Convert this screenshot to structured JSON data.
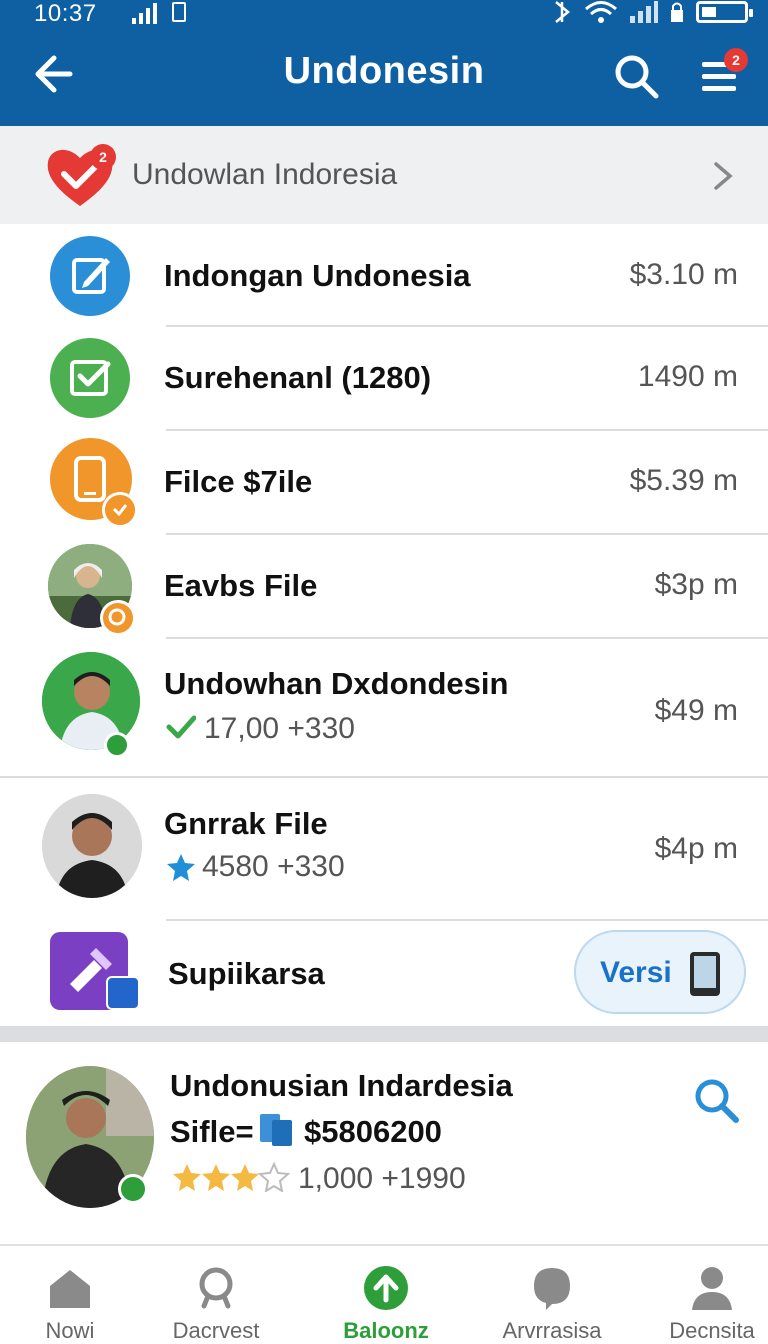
{
  "status_bar": {
    "time": "10:37"
  },
  "app_bar": {
    "title": "Undonesin",
    "menu_badge": "2"
  },
  "banner": {
    "text": "Undowlan Indoresia",
    "badge": "2"
  },
  "rows": [
    {
      "title": "Indongan Undonesia",
      "value": "$3.10 m",
      "icon": "edit-icon",
      "color": "#2a8fd6"
    },
    {
      "title": "Surehenanl (1280)",
      "value": "1490 m",
      "icon": "checkbox-icon",
      "color": "#4caf50"
    },
    {
      "title": "Filce $7ile",
      "value": "$5.39 m",
      "icon": "phone-icon",
      "color": "#f0962a"
    },
    {
      "title": "Eavbs File",
      "value": "$3p m",
      "icon": "avatar-photo"
    },
    {
      "title": "Undowhan Dxdondesin",
      "sub": "17,00 +330",
      "value": "$49 m",
      "icon": "avatar-photo"
    },
    {
      "title": "Gnrrak File",
      "sub": "4580 +330",
      "value": "$4p m",
      "icon": "avatar-photo"
    },
    {
      "title": "Supiikarsa",
      "button": "Versi",
      "icon": "puzzle-icon",
      "color": "#7b3fc4"
    }
  ],
  "featured": {
    "title": "Undonusian Indardesia",
    "line2_prefix": "Sifle=",
    "line2_value": "$5806200",
    "rating": "3.5",
    "rating_text": "1,000 +1990"
  },
  "bottom_nav": [
    {
      "label": "Nowi",
      "icon": "home-icon"
    },
    {
      "label": "Dacrvest",
      "icon": "search-icon"
    },
    {
      "label": "Baloonz",
      "icon": "upload-icon"
    },
    {
      "label": "Arvrrasisa",
      "icon": "chat-icon"
    },
    {
      "label": "Decnsita",
      "icon": "profile-icon"
    }
  ],
  "colors": {
    "primary": "#0f5fa3",
    "accent_green": "#2e9e3a",
    "badge_red": "#e53935"
  }
}
